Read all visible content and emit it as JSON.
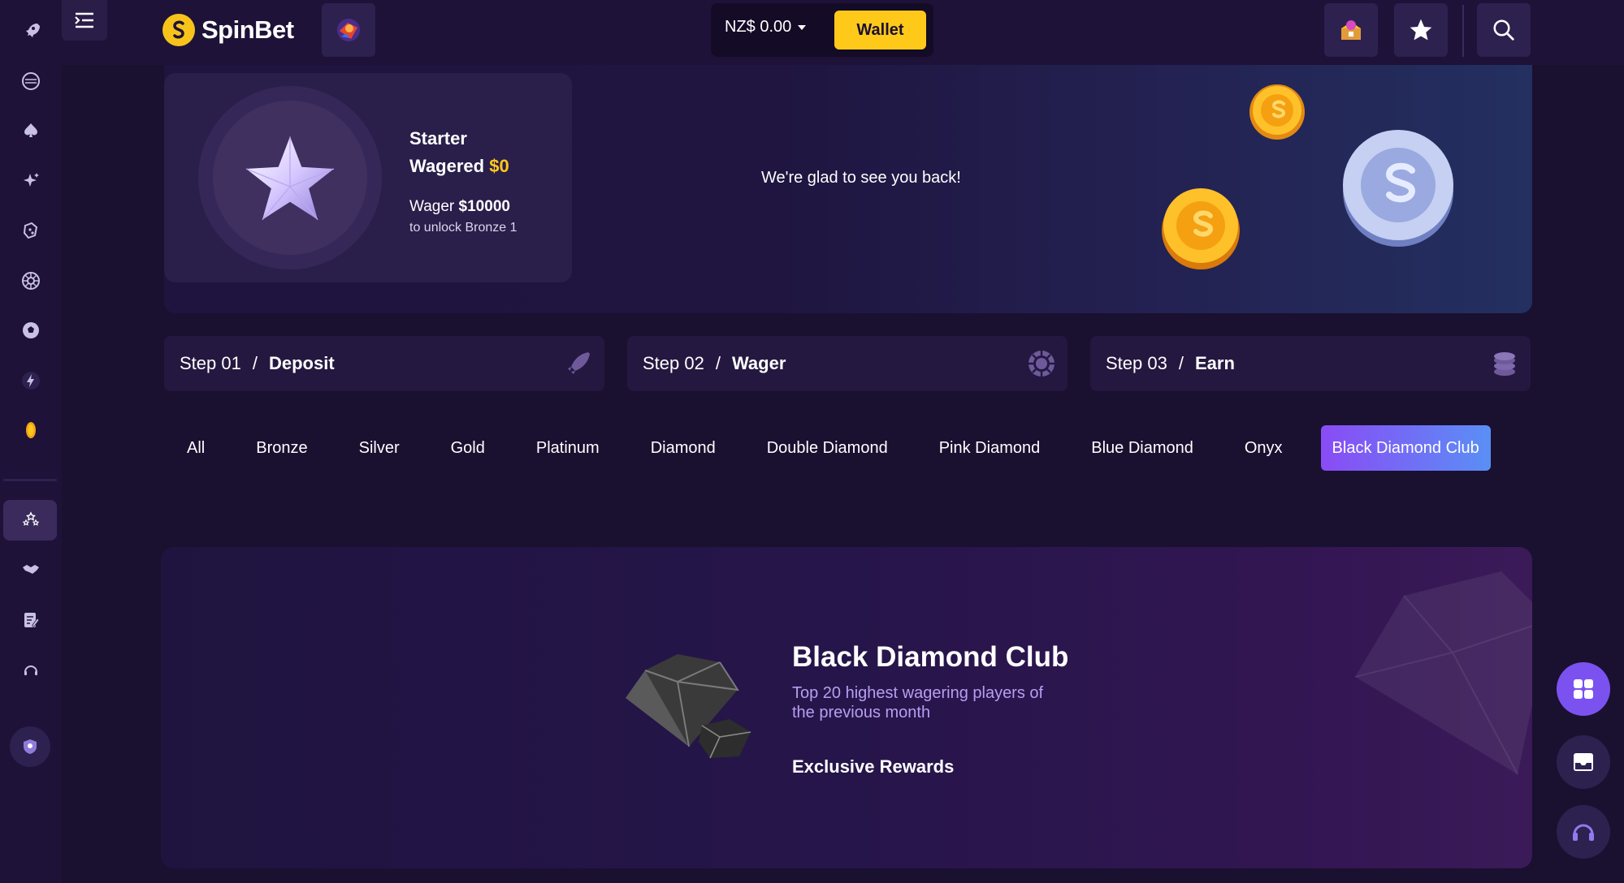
{
  "header": {
    "brand": "SpinBet",
    "balance": "NZ$ 0.00",
    "wallet_label": "Wallet"
  },
  "hero": {
    "tier_name": "Starter",
    "wagered_label": "Wagered",
    "wagered_value": "$0",
    "wager_label": "Wager",
    "wager_amount": "$10000",
    "unlock_text": "to unlock Bronze 1",
    "greeting": "We're glad to see you back!"
  },
  "steps": [
    {
      "num": "Step 01",
      "sep": "/",
      "title": "Deposit",
      "icon": "rocket-icon"
    },
    {
      "num": "Step 02",
      "sep": "/",
      "title": "Wager",
      "icon": "chip-icon"
    },
    {
      "num": "Step 03",
      "sep": "/",
      "title": "Earn",
      "icon": "coin-stack-icon"
    }
  ],
  "tabs": [
    "All",
    "Bronze",
    "Silver",
    "Gold",
    "Platinum",
    "Diamond",
    "Double Diamond",
    "Pink Diamond",
    "Blue Diamond",
    "Onyx",
    "Black Diamond Club"
  ],
  "active_tab": "Black Diamond Club",
  "detail": {
    "title": "Black Diamond Club",
    "subtitle": "Top 20 highest wagering players of the previous month",
    "rewards_label": "Exclusive Rewards"
  },
  "colors": {
    "accent_gold": "#ffc91a",
    "tab_active_start": "#8a4bf5",
    "tab_active_end": "#5a8ff5",
    "background": "#1a1030"
  }
}
